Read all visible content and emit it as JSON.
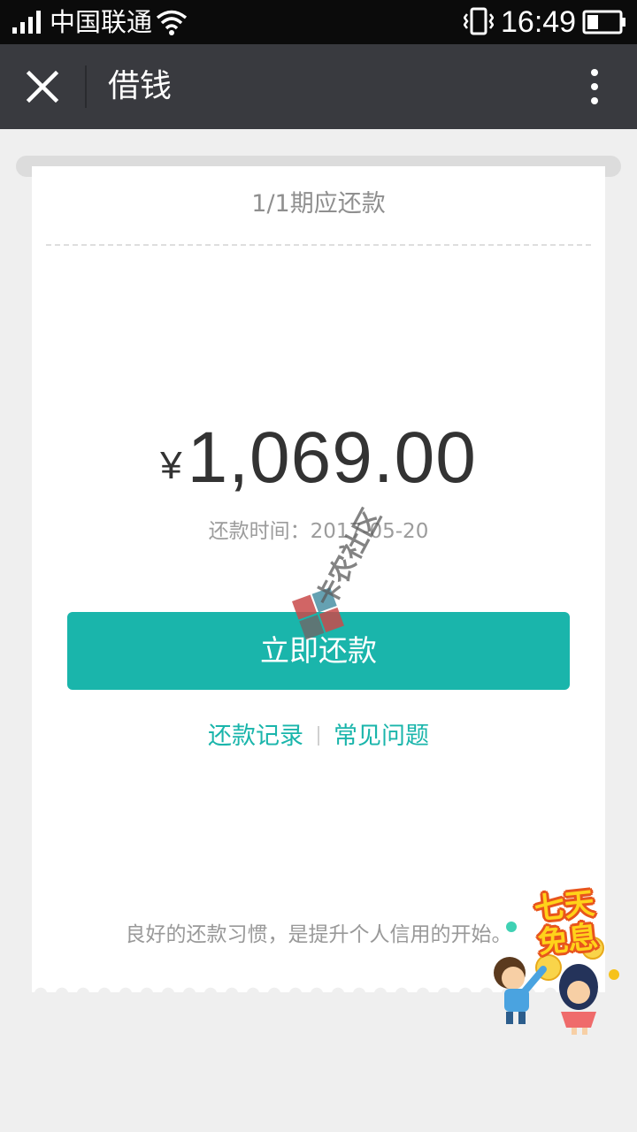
{
  "status_bar": {
    "carrier": "中国联通",
    "time": "16:49",
    "icons": [
      "signal-icon",
      "wifi-icon",
      "vibrate-icon",
      "battery-icon"
    ]
  },
  "nav": {
    "title": "借钱",
    "close_icon": "close-icon",
    "more_icon": "more-vertical-icon"
  },
  "bill": {
    "period_label": "1/1期应还款",
    "currency_symbol": "¥",
    "amount": "1,069.00",
    "due_label": "还款时间：",
    "due_date": "2017-05-20",
    "repay_button": "立即还款",
    "links": [
      "还款记录",
      "常见问题"
    ],
    "slogan": "良好的还款习惯，是提升个人信用的开始。"
  },
  "watermark": {
    "text": "卡农社区"
  },
  "promo": {
    "line1": "七天",
    "line2": "免息"
  },
  "colors": {
    "accent": "#1ab5ab",
    "nav_bg": "#393a3f",
    "status_bg": "#0b0b0b",
    "page_bg": "#efefef"
  }
}
